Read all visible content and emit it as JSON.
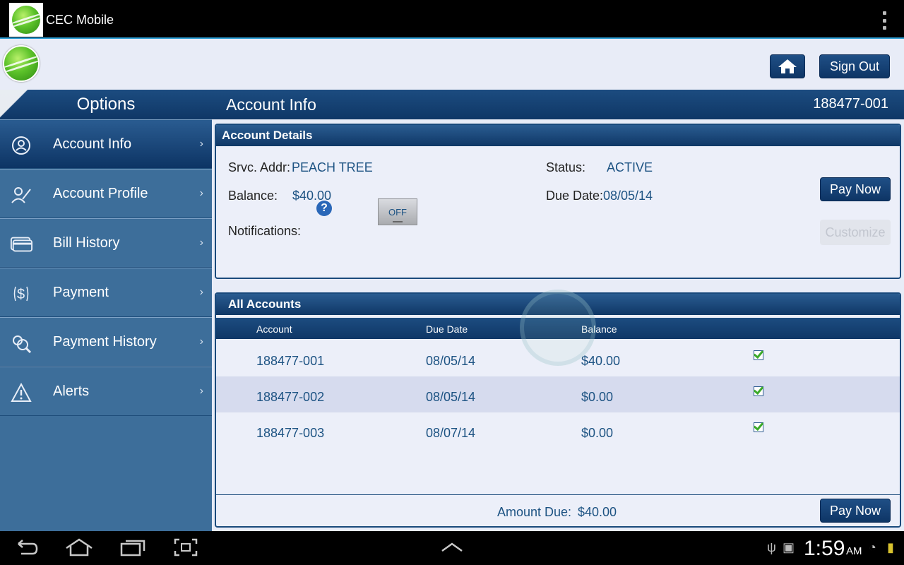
{
  "app": {
    "title": "CEC Mobile"
  },
  "header": {
    "signout_label": "Sign Out"
  },
  "sidebar": {
    "title": "Options",
    "items": [
      {
        "label": "Account Info",
        "icon": "account-icon"
      },
      {
        "label": "Account Profile",
        "icon": "profile-edit-icon"
      },
      {
        "label": "Bill History",
        "icon": "bill-history-icon"
      },
      {
        "label": "Payment",
        "icon": "dollar-icon"
      },
      {
        "label": "Payment History",
        "icon": "payment-history-icon"
      },
      {
        "label": "Alerts",
        "icon": "warning-icon"
      }
    ]
  },
  "main": {
    "title": "Account Info",
    "account_number": "188477-001",
    "details": {
      "header": "Account Details",
      "srvc_label": "Srvc. Addr:",
      "srvc_value": "PEACH TREE",
      "status_label": "Status:",
      "status_value": "ACTIVE",
      "balance_label": "Balance:",
      "balance_value": "$40.00",
      "due_label": "Due Date:",
      "due_value": "08/05/14",
      "notifications_label": "Notifications:",
      "toggle_value": "OFF",
      "pay_now_label": "Pay Now",
      "customize_label": "Customize"
    },
    "accounts": {
      "header": "All Accounts",
      "columns": [
        "Account",
        "Due Date",
        "Balance"
      ],
      "rows": [
        {
          "account": "188477-001",
          "due": "08/05/14",
          "balance": "$40.00"
        },
        {
          "account": "188477-002",
          "due": "08/05/14",
          "balance": "$0.00"
        },
        {
          "account": "188477-003",
          "due": "08/07/14",
          "balance": "$0.00"
        }
      ],
      "amount_due_label": "Amount Due:",
      "amount_due_value": "$40.00",
      "pay_now_label": "Pay Now"
    }
  },
  "statusbar": {
    "time": "1:59",
    "ampm": "AM"
  },
  "colors": {
    "brand_dark": "#0f3766",
    "sidebar": "#3d6e9a",
    "accent_text": "#1d5383"
  }
}
